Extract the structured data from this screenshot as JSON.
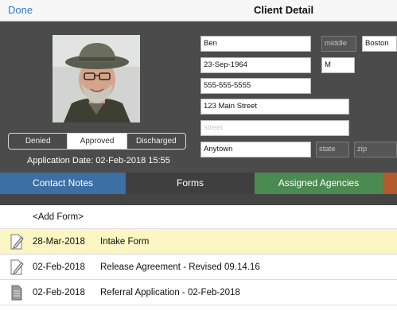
{
  "nav": {
    "done_label": "Done",
    "title": "Client Detail"
  },
  "client": {
    "first_name": "Ben",
    "middle_placeholder": "middle",
    "last_name": "Boston",
    "dob": "23-Sep-1964",
    "gender": "M",
    "phone": "555-555-5555",
    "street1": "123 Main Street",
    "street2_placeholder": "street",
    "city": "Anytown",
    "state_placeholder": "state",
    "zip_placeholder": "zip"
  },
  "status": {
    "options": [
      "Denied",
      "Approved",
      "Discharged"
    ],
    "selected": "Approved"
  },
  "application_date": "Application Date: 02-Feb-2018 15:55",
  "tabs": [
    {
      "label": "Contact Notes",
      "color": "#3c6fa3"
    },
    {
      "label": "Forms",
      "color": "#3f3f3f"
    },
    {
      "label": "Assigned Agencies",
      "color": "#4b8b52"
    }
  ],
  "forms": {
    "add_label": "<Add Form>",
    "rows": [
      {
        "date": "28-Mar-2018",
        "name": "Intake Form",
        "icon": "edit-document-icon",
        "highlighted": true
      },
      {
        "date": "02-Feb-2018",
        "name": "Release Agreement - Revised 09.14.16",
        "icon": "edit-document-icon",
        "highlighted": false
      },
      {
        "date": "02-Feb-2018",
        "name": "Referral Application - 02-Feb-2018",
        "icon": "document-icon",
        "highlighted": false
      }
    ]
  }
}
